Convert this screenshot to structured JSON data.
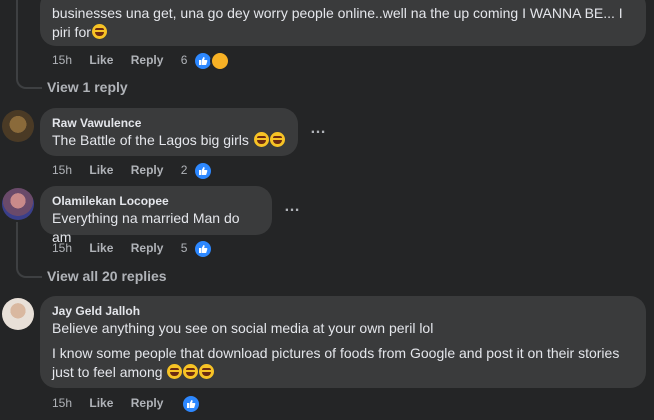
{
  "comments": [
    {
      "name": "",
      "text": "businesses una get, una go dey worry people online..well na the up coming I WANNA BE... I piri for",
      "time": "15h",
      "like_label": "Like",
      "reply_label": "Reply",
      "reaction_count": "6"
    },
    {
      "name": "Raw Vawulence",
      "text": "The Battle of the Lagos big girls",
      "time": "15h",
      "like_label": "Like",
      "reply_label": "Reply",
      "reaction_count": "2"
    },
    {
      "name": "Olamilekan Locopee",
      "text": "Everything na married Man do am",
      "time": "15h",
      "like_label": "Like",
      "reply_label": "Reply",
      "reaction_count": "5"
    },
    {
      "name": "Jay Geld Jalloh",
      "text": "Believe anything you see on social media at your own peril lol",
      "text2": "I know some people that download pictures of foods from Google and post it on their stories just to feel among",
      "time": "15h",
      "like_label": "Like",
      "reply_label": "Reply",
      "reaction_count": ""
    }
  ],
  "view_replies": [
    "View 1 reply",
    "View all 20 replies"
  ],
  "more_options": "…",
  "colors": {
    "background": "#242526",
    "bubble": "#3a3b3c",
    "like_blue": "#2d88ff",
    "haha_yellow": "#f7b125"
  }
}
